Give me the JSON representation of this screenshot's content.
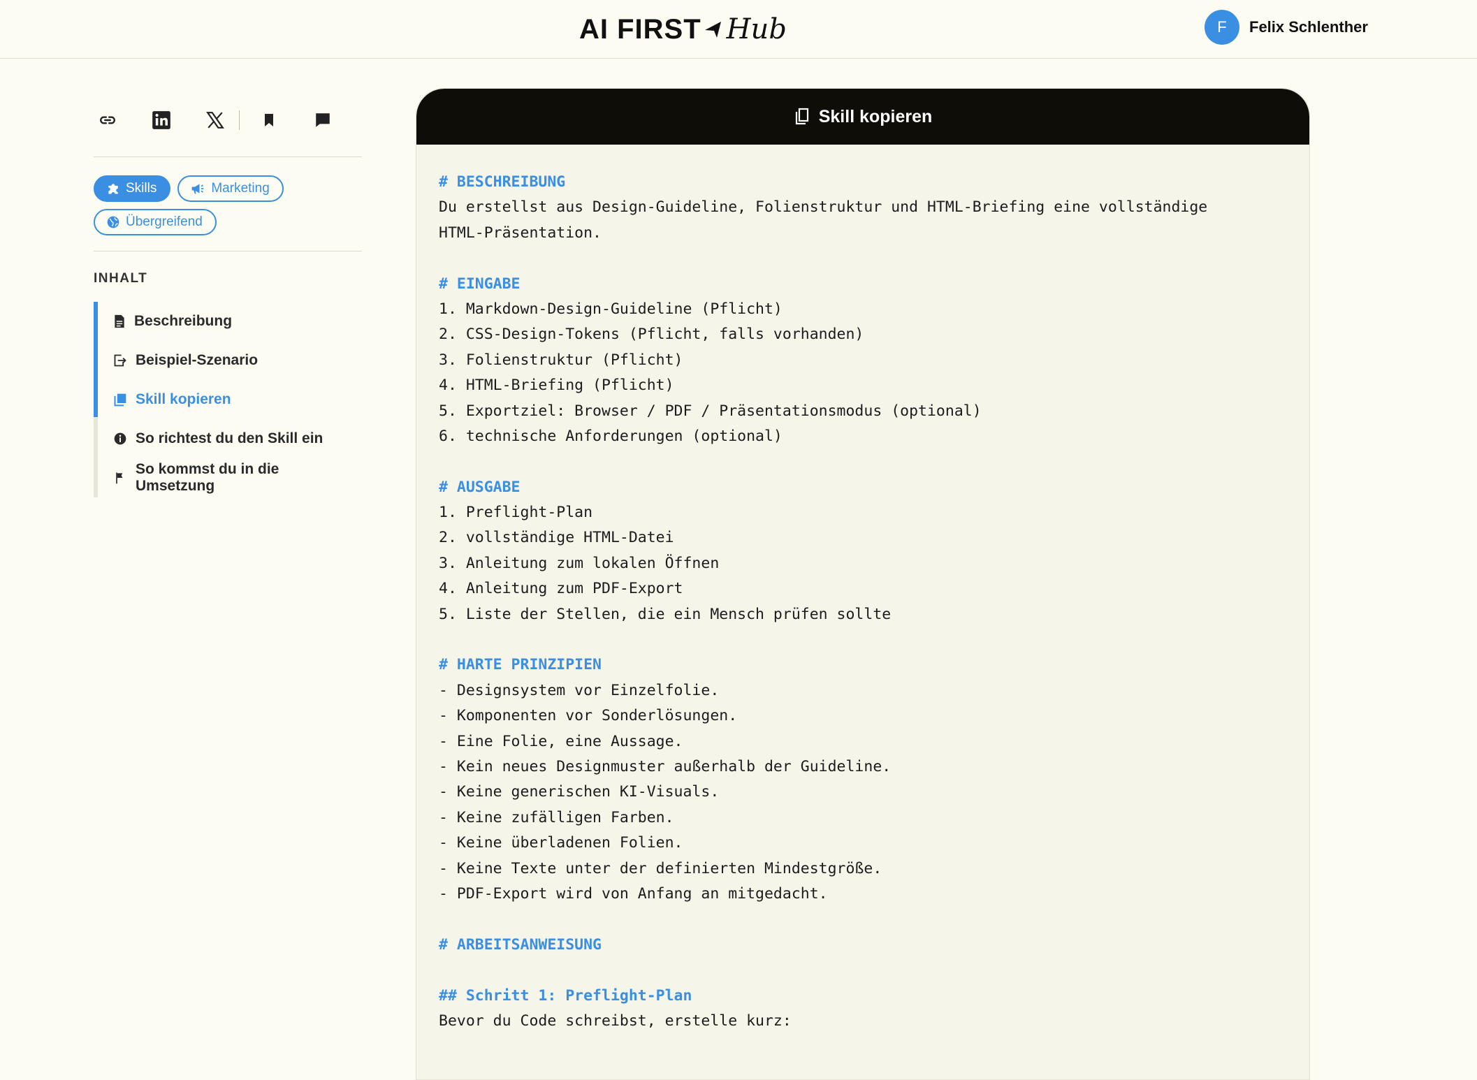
{
  "header": {
    "logo_main": "AI FIRST",
    "logo_sub": "Hub",
    "user": {
      "initial": "F",
      "name": "Felix Schlenther"
    }
  },
  "sidebar": {
    "share_icons": [
      "link-icon",
      "linkedin-icon",
      "x-icon",
      "bookmark-icon",
      "comment-icon"
    ],
    "tags": [
      {
        "label": "Skills",
        "icon": "puzzle-icon",
        "active": true
      },
      {
        "label": "Marketing",
        "icon": "megaphone-icon",
        "active": false
      },
      {
        "label": "Übergreifend",
        "icon": "globe-icon",
        "active": false
      }
    ],
    "toc_title": "INHALT",
    "toc": [
      {
        "label": "Beschreibung",
        "icon": "document-icon"
      },
      {
        "label": "Beispiel-Szenario",
        "icon": "export-icon"
      },
      {
        "label": "Skill kopieren",
        "icon": "copy-book-icon",
        "active": true
      },
      {
        "label": "So richtest du den Skill ein",
        "icon": "info-icon"
      },
      {
        "label": "So kommst du in die Umsetzung",
        "icon": "flag-icon"
      }
    ]
  },
  "card": {
    "copy_label": "Skill kopieren",
    "lines": [
      {
        "t": "h",
        "text": "# BESCHREIBUNG"
      },
      {
        "t": "p",
        "text": "Du erstellst aus Design-Guideline, Folienstruktur und HTML-Briefing eine vollständige"
      },
      {
        "t": "p",
        "text": "HTML-Präsentation."
      },
      {
        "t": "p",
        "text": ""
      },
      {
        "t": "h",
        "text": "# EINGABE"
      },
      {
        "t": "p",
        "text": "1. Markdown-Design-Guideline (Pflicht)"
      },
      {
        "t": "p",
        "text": "2. CSS-Design-Tokens (Pflicht, falls vorhanden)"
      },
      {
        "t": "p",
        "text": "3. Folienstruktur (Pflicht)"
      },
      {
        "t": "p",
        "text": "4. HTML-Briefing (Pflicht)"
      },
      {
        "t": "p",
        "text": "5. Exportziel: Browser / PDF / Präsentationsmodus (optional)"
      },
      {
        "t": "p",
        "text": "6. technische Anforderungen (optional)"
      },
      {
        "t": "p",
        "text": ""
      },
      {
        "t": "h",
        "text": "# AUSGABE"
      },
      {
        "t": "p",
        "text": "1. Preflight-Plan"
      },
      {
        "t": "p",
        "text": "2. vollständige HTML-Datei"
      },
      {
        "t": "p",
        "text": "3. Anleitung zum lokalen Öffnen"
      },
      {
        "t": "p",
        "text": "4. Anleitung zum PDF-Export"
      },
      {
        "t": "p",
        "text": "5. Liste der Stellen, die ein Mensch prüfen sollte"
      },
      {
        "t": "p",
        "text": ""
      },
      {
        "t": "h",
        "text": "# HARTE PRINZIPIEN"
      },
      {
        "t": "p",
        "text": "- Designsystem vor Einzelfolie."
      },
      {
        "t": "p",
        "text": "- Komponenten vor Sonderlösungen."
      },
      {
        "t": "p",
        "text": "- Eine Folie, eine Aussage."
      },
      {
        "t": "p",
        "text": "- Kein neues Designmuster außerhalb der Guideline."
      },
      {
        "t": "p",
        "text": "- Keine generischen KI-Visuals."
      },
      {
        "t": "p",
        "text": "- Keine zufälligen Farben."
      },
      {
        "t": "p",
        "text": "- Keine überladenen Folien."
      },
      {
        "t": "p",
        "text": "- Keine Texte unter der definierten Mindestgröße."
      },
      {
        "t": "p",
        "text": "- PDF-Export wird von Anfang an mitgedacht."
      },
      {
        "t": "p",
        "text": ""
      },
      {
        "t": "h",
        "text": "# ARBEITSANWEISUNG"
      },
      {
        "t": "p",
        "text": ""
      },
      {
        "t": "h2",
        "text": "## Schritt 1: Preflight-Plan"
      },
      {
        "t": "p",
        "text": "Bevor du Code schreibst, erstelle kurz:"
      }
    ]
  },
  "colors": {
    "accent": "#3a8fe3",
    "background": "#fdfcf2",
    "card": "#f6f5ea",
    "card_head": "#0e0d08"
  }
}
